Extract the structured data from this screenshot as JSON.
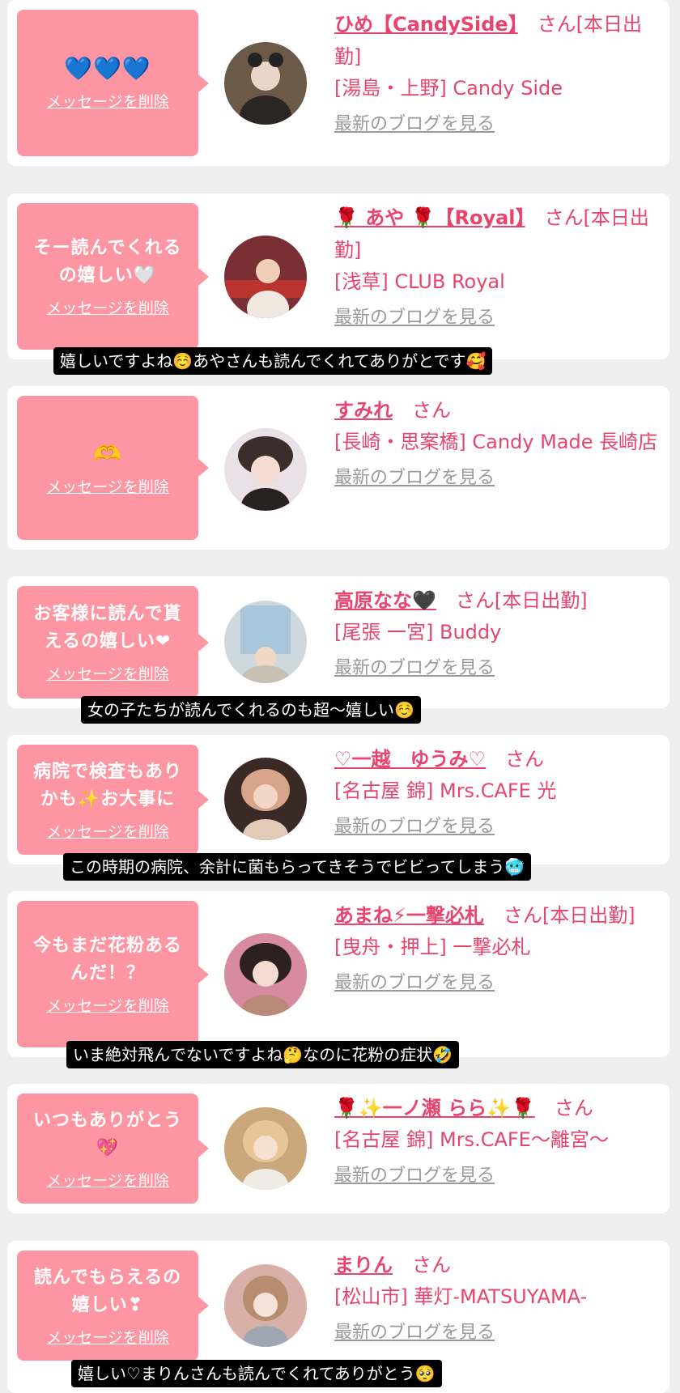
{
  "delete_label": "メッセージを削除",
  "blog_label": "最新のブログを見る",
  "san_label": "さん",
  "cards": [
    {
      "message": "💙💙💙",
      "name": "ひめ【CandySide】",
      "san": "さん[本日出勤]",
      "shop": "[湯島・上野] Candy Side",
      "avatar_color": "#6b5a4a"
    },
    {
      "message": "そー読んでくれるの嬉しい🤍",
      "name": "🌹 あや 🌹【Royal】",
      "san": "さん[本日出勤]",
      "shop": "[浅草] CLUB Royal",
      "avatar_color": "#7a2f35"
    },
    {
      "message": "🫶",
      "name": "すみれ",
      "san": "さん",
      "shop": "[長崎・思案橋] Candy Made 長崎店",
      "avatar_color": "#e9e1e6"
    },
    {
      "message": "お客様に読んで貰えるの嬉しい❤",
      "name": "高原なな🖤",
      "san": "さん[本日出勤]",
      "shop": "[尾張 一宮] Buddy",
      "avatar_color": "#cfd8dc"
    },
    {
      "message": "病院で検査もありかも✨お大事に",
      "name": "♡一越　ゆうみ♡",
      "san": "さん",
      "shop": "[名古屋 錦] Mrs.CAFE 光",
      "avatar_color": "#3a2a25"
    },
    {
      "message": "今もまだ花粉あるんだ！？",
      "name": "あまね⚡一撃必札",
      "san": "さん[本日出勤]",
      "shop": "[曳舟・押上] 一撃必札",
      "avatar_color": "#d88aa0"
    },
    {
      "message": "いつもありがとう💖",
      "name": "🌹✨一ノ瀬 らら✨🌹",
      "san": "さん",
      "shop": "[名古屋 錦] Mrs.CAFE〜離宮〜",
      "avatar_color": "#c9a77a"
    },
    {
      "message": "読んでもらえるの嬉しい❣",
      "name": "まりん",
      "san": "さん",
      "shop": "[松山市] 華灯-MATSUYAMA-",
      "avatar_color": "#d9b0a8"
    }
  ],
  "captions": [
    "嬉しいですよね☺️あやさんも読んでくれてありがとです🥰",
    "女の子たちが読んでくれるのも超〜嬉しい☺️",
    "この時期の病院、余計に菌もらってきそうでビビってしまう🥶",
    "いま絶対飛んでないですよね🤔なのに花粉の症状🤣",
    "嬉しい♡まりんさんも読んでくれてありがとう🥺"
  ]
}
